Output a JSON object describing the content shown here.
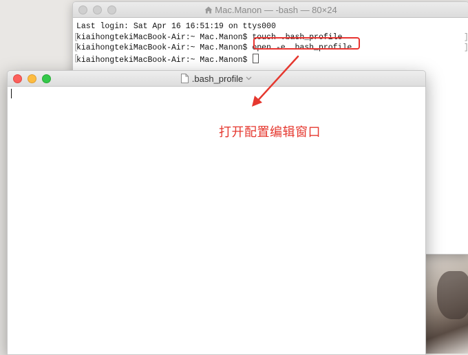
{
  "terminal": {
    "title": "Mac.Manon — -bash — 80×24",
    "lines": [
      "Last login: Sat Apr 16 16:51:19 on ttys000",
      "kiaihongtekiMacBook-Air:~ Mac.Manon$ touch .bash_profile",
      "kiaihongtekiMacBook-Air:~ Mac.Manon$ open -e .bash_profile",
      "kiaihongtekiMacBook-Air:~ Mac.Manon$ "
    ]
  },
  "editor": {
    "title": ".bash_profile"
  },
  "annotation": {
    "text": "打开配置编辑窗口",
    "color": "#e5382f"
  },
  "icons": [
    "home-icon",
    "document-icon",
    "chevron-down-icon"
  ]
}
